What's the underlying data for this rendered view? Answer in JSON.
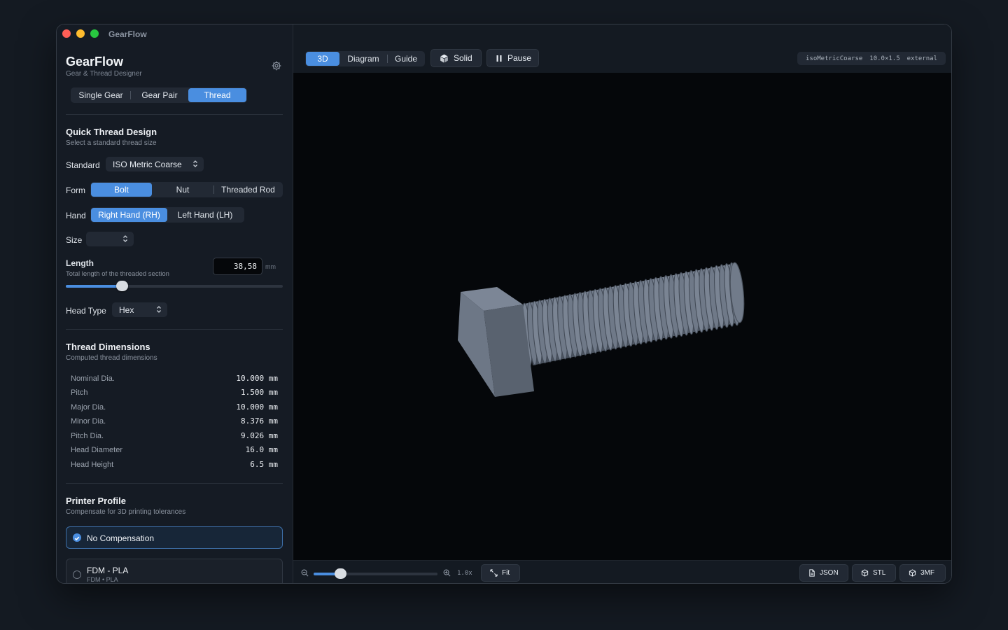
{
  "window": {
    "title": "GearFlow"
  },
  "app": {
    "title": "GearFlow",
    "subtitle": "Gear & Thread Designer"
  },
  "mode_tabs": [
    {
      "label": "Single Gear",
      "active": false
    },
    {
      "label": "Gear Pair",
      "active": false
    },
    {
      "label": "Thread",
      "active": true
    }
  ],
  "quick_design": {
    "title": "Quick Thread Design",
    "subtitle": "Select a standard thread size",
    "standard_label": "Standard",
    "standard_value": "ISO Metric Coarse",
    "form_label": "Form",
    "form_options": [
      {
        "label": "Bolt",
        "active": true
      },
      {
        "label": "Nut",
        "active": false
      },
      {
        "label": "Threaded Rod",
        "active": false
      }
    ],
    "hand_label": "Hand",
    "hand_options": [
      {
        "label": "Right Hand (RH)",
        "active": true
      },
      {
        "label": "Left Hand (LH)",
        "active": false
      }
    ],
    "size_label": "Size",
    "size_value": "",
    "length_label": "Length",
    "length_sub": "Total length of the threaded section",
    "length_value": "38,58",
    "length_unit": "mm",
    "length_slider_percent": 26,
    "head_label": "Head Type",
    "head_value": "Hex"
  },
  "thread_dimensions": {
    "title": "Thread Dimensions",
    "subtitle": "Computed thread dimensions",
    "rows": [
      {
        "label": "Nominal Dia.",
        "value": "10.000 mm"
      },
      {
        "label": "Pitch",
        "value": "1.500 mm"
      },
      {
        "label": "Major Dia.",
        "value": "10.000 mm"
      },
      {
        "label": "Minor Dia.",
        "value": "8.376 mm"
      },
      {
        "label": "Pitch Dia.",
        "value": "9.026 mm"
      },
      {
        "label": "Head Diameter",
        "value": "16.0 mm"
      },
      {
        "label": "Head Height",
        "value": "6.5 mm"
      }
    ]
  },
  "printer_profile": {
    "title": "Printer Profile",
    "subtitle": "Compensate for 3D printing tolerances",
    "options": [
      {
        "name": "No Compensation",
        "meta": "",
        "selected": true
      },
      {
        "name": "FDM - PLA",
        "meta": "FDM • PLA",
        "selected": false
      }
    ]
  },
  "toolbar": {
    "view_tabs": [
      {
        "label": "3D",
        "active": true
      },
      {
        "label": "Diagram",
        "active": false
      },
      {
        "label": "Guide",
        "active": false
      }
    ],
    "solid_label": "Solid",
    "pause_label": "Pause",
    "tags": [
      "isoMetricCoarse",
      "10.0×1.5",
      "external"
    ]
  },
  "bottombar": {
    "zoom_value": "1.0x",
    "zoom_slider_percent": 22,
    "fit_label": "Fit",
    "export_buttons": [
      "JSON",
      "STL",
      "3MF"
    ]
  },
  "icons": {
    "settings": "gear-icon",
    "solid": "cube-icon",
    "pause": "pause-icon",
    "zoom_out": "zoom-out-icon",
    "zoom_in": "zoom-in-icon",
    "fit": "fit-icon",
    "json": "file-icon",
    "stl": "cube-icon",
    "3mf": "cube-icon"
  },
  "colors": {
    "accent": "#4a8ee0",
    "bolt": "#6b7585"
  }
}
